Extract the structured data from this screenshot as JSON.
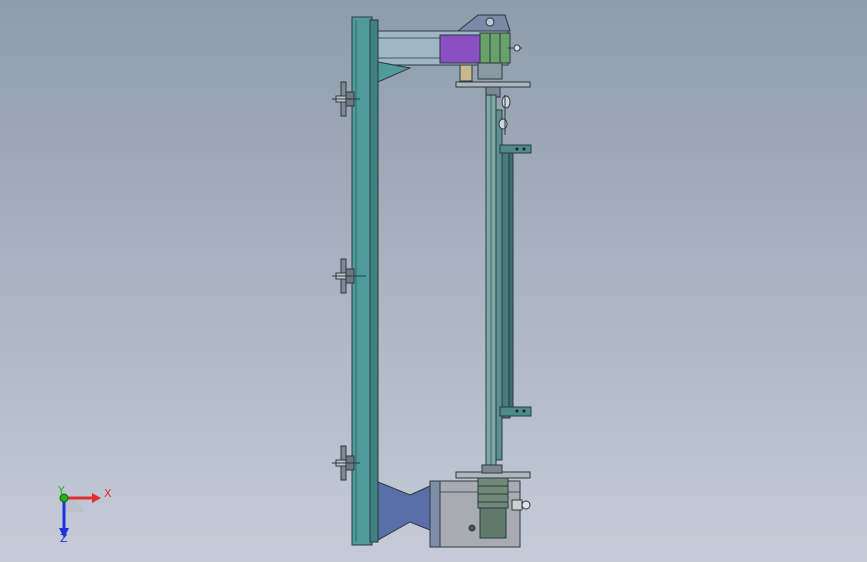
{
  "triad": {
    "x_label": "X",
    "y_label": "Y",
    "z_label": "Z",
    "x_color": "#e03030",
    "y_color": "#20b020",
    "z_color": "#2030e0"
  },
  "colors": {
    "frame": "#4f9a9a",
    "frame_dark": "#2e6a6a",
    "arm": "#9fb6c6",
    "motor_purple": "#8a4fc0",
    "motor_green": "#6aa06a",
    "mount_blue": "#5a6ea8",
    "housing_gray": "#a9abb3",
    "rail": "#5f9090",
    "outline": "#2a3a40"
  }
}
